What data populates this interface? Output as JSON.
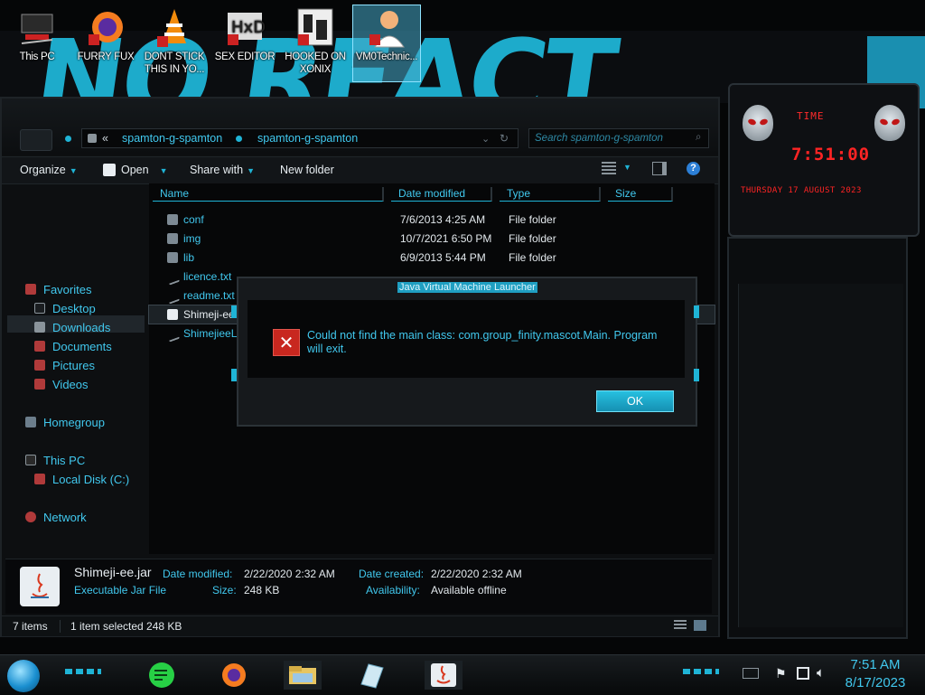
{
  "desktop": {
    "icons": [
      {
        "label": "This PC"
      },
      {
        "label": "FURRY FUX"
      },
      {
        "label": "DONT STICK THIS IN YO..."
      },
      {
        "label": "SEX EDITOR"
      },
      {
        "label": "HOOKED ON XONIX"
      },
      {
        "label": "VM0Technic..."
      }
    ]
  },
  "explorer": {
    "address": {
      "chevrons": "«",
      "crumb1": "spamton-g-spamton",
      "crumb2": "spamton-g-spamton"
    },
    "search_placeholder": "Search spamton-g-spamton",
    "toolbar": {
      "organize": "Organize",
      "open": "Open",
      "share_with": "Share with",
      "new_folder": "New folder"
    },
    "sidebar": {
      "favorites": "Favorites",
      "desktop": "Desktop",
      "downloads": "Downloads",
      "documents": "Documents",
      "pictures": "Pictures",
      "videos": "Videos",
      "homegroup": "Homegroup",
      "this_pc": "This PC",
      "local_disk": "Local Disk (C:)",
      "network": "Network"
    },
    "columns": {
      "name": "Name",
      "date": "Date modified",
      "type": "Type",
      "size": "Size"
    },
    "files": [
      {
        "name": "conf",
        "date": "7/6/2013 4:25 AM",
        "type": "File folder"
      },
      {
        "name": "img",
        "date": "10/7/2021 6:50 PM",
        "type": "File folder"
      },
      {
        "name": "lib",
        "date": "6/9/2013 5:44 PM",
        "type": "File folder"
      },
      {
        "name": "licence.txt",
        "date": "",
        "type": ""
      },
      {
        "name": "readme.txt",
        "date": "",
        "type": ""
      },
      {
        "name": "Shimeji-ee",
        "date": "",
        "type": ""
      },
      {
        "name": "ShimejieeL",
        "date": "",
        "type": ""
      }
    ],
    "details": {
      "filename": "Shimeji-ee.jar",
      "filetype": "Executable Jar File",
      "date_modified_label": "Date modified:",
      "date_modified": "2/22/2020 2:32 AM",
      "size_label": "Size:",
      "size": "248 KB",
      "date_created_label": "Date created:",
      "date_created": "2/22/2020 2:32 AM",
      "availability_label": "Availability:",
      "availability": "Available offline"
    },
    "status": {
      "items": "7 items",
      "selected": "1 item selected  248 KB"
    }
  },
  "dialog": {
    "title": "Java Virtual Machine Launcher",
    "message": "Could not find the main class: com.group_finity.mascot.Main. Program will exit.",
    "ok": "OK",
    "icon": "error-x-icon"
  },
  "gadget": {
    "label": "TIME",
    "time": "7:51:00",
    "date": "THURSDAY 17 AUGUST 2023"
  },
  "taskbar": {
    "time": "7:51 AM",
    "date": "8/17/2023"
  },
  "colors": {
    "accent": "#1fb4d6",
    "error": "#c8271f",
    "gadget_red": "#ff2424"
  }
}
